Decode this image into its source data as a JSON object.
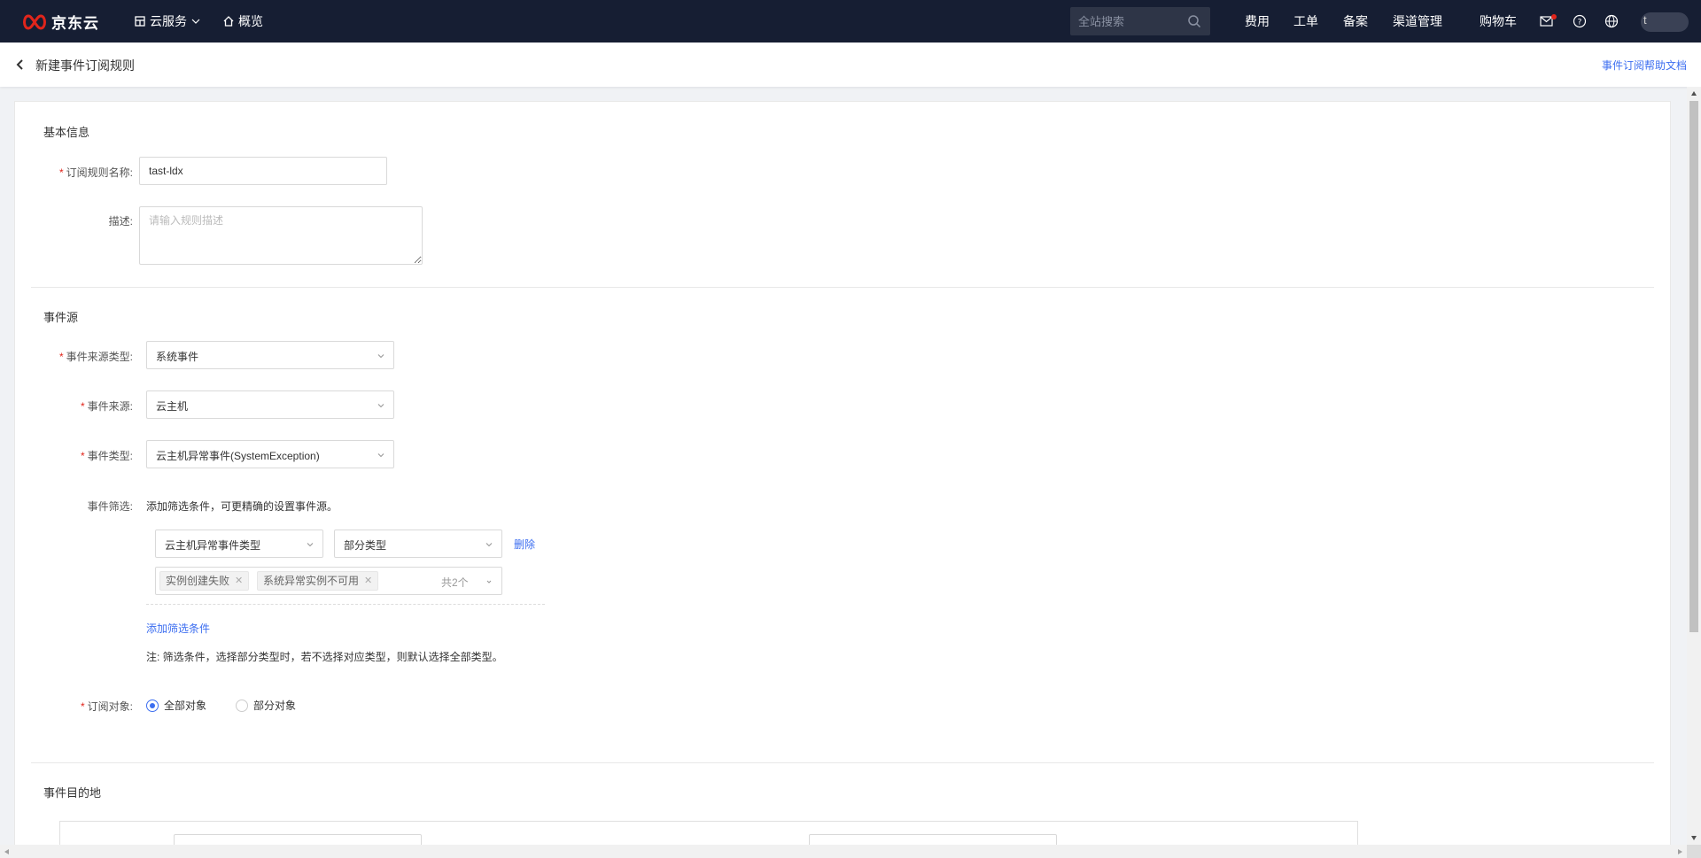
{
  "topnav": {
    "brand": "京东云",
    "cloud_services": "云服务",
    "overview": "概览",
    "search_placeholder": "全站搜索",
    "links": [
      "费用",
      "工单",
      "备案",
      "渠道管理",
      "购物车"
    ],
    "avatar_letter": "t",
    "brand_color": "#e1251b",
    "bg_color": "#161e33"
  },
  "header": {
    "title": "新建事件订阅规则",
    "help_link": "事件订阅帮助文档"
  },
  "basic_info": {
    "section_title": "基本信息",
    "rule_name_label": "订阅规则名称:",
    "rule_name_value": "tast-ldx",
    "desc_label": "描述:",
    "desc_placeholder": "请输入规则描述"
  },
  "event_source": {
    "section_title": "事件源",
    "source_type_label": "事件来源类型:",
    "source_type_value": "系统事件",
    "source_label": "事件来源:",
    "source_value": "云主机",
    "event_type_label": "事件类型:",
    "event_type_value": "云主机异常事件(SystemException)",
    "filter_label": "事件筛选:",
    "filter_hint": "添加筛选条件，可更精确的设置事件源。",
    "filter_field_value": "云主机异常事件类型",
    "filter_scope_value": "部分类型",
    "delete_label": "删除",
    "tags": [
      "实例创建失败",
      "系统异常实例不可用"
    ],
    "tag_count": "共2个",
    "add_filter_label": "添加筛选条件",
    "note": "注: 筛选条件，选择部分类型时，若不选择对应类型，则默认选择全部类型。",
    "target_label": "订阅对象:",
    "target_options": [
      "全部对象",
      "部分对象"
    ],
    "target_selected": "全部对象"
  },
  "destination": {
    "section_title": "事件目的地"
  },
  "accent_color": "#3c6ef0"
}
